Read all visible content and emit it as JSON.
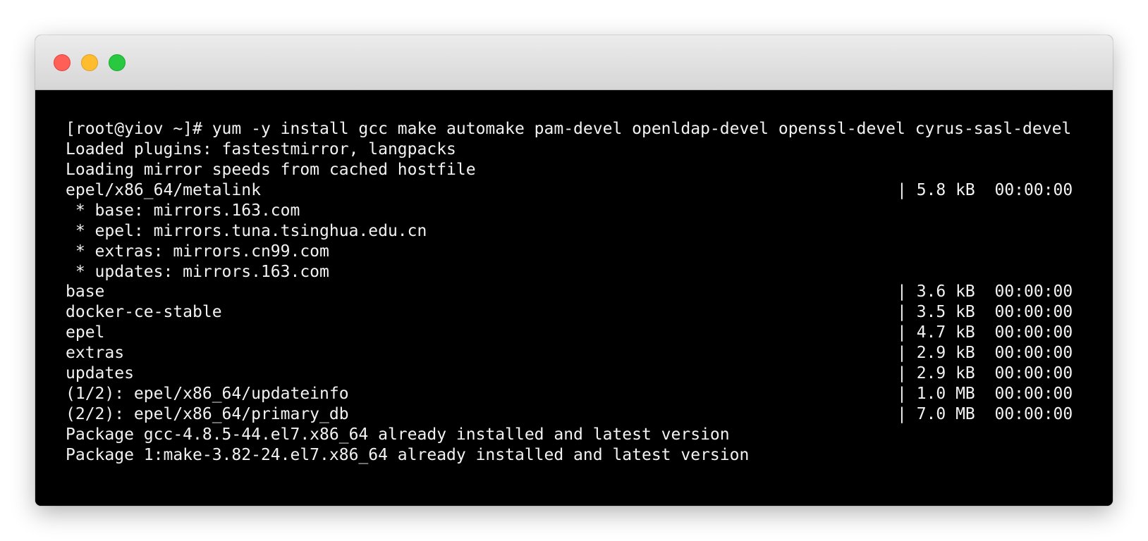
{
  "window": {
    "colors": {
      "close": "#ff5f57",
      "minimize": "#febc2e",
      "zoom": "#28c840",
      "terminal_bg": "#000000",
      "text": "#f2f2f2"
    }
  },
  "terminal": {
    "lines": [
      {
        "text": "[root@yiov ~]# yum -y install gcc make automake pam-devel openldap-devel openssl-devel cyrus-sasl-devel"
      },
      {
        "text": "Loaded plugins: fastestmirror, langpacks"
      },
      {
        "text": "Loading mirror speeds from cached hostfile"
      },
      {
        "text": "epel/x86_64/metalink",
        "stat": "| 5.8 kB  00:00:00"
      },
      {
        "text": " * base: mirrors.163.com"
      },
      {
        "text": " * epel: mirrors.tuna.tsinghua.edu.cn"
      },
      {
        "text": " * extras: mirrors.cn99.com"
      },
      {
        "text": " * updates: mirrors.163.com"
      },
      {
        "text": "base",
        "stat": "| 3.6 kB  00:00:00"
      },
      {
        "text": "docker-ce-stable",
        "stat": "| 3.5 kB  00:00:00"
      },
      {
        "text": "epel",
        "stat": "| 4.7 kB  00:00:00"
      },
      {
        "text": "extras",
        "stat": "| 2.9 kB  00:00:00"
      },
      {
        "text": "updates",
        "stat": "| 2.9 kB  00:00:00"
      },
      {
        "text": "(1/2): epel/x86_64/updateinfo",
        "stat": "| 1.0 MB  00:00:00"
      },
      {
        "text": "(2/2): epel/x86_64/primary_db",
        "stat": "| 7.0 MB  00:00:00"
      },
      {
        "text": "Package gcc-4.8.5-44.el7.x86_64 already installed and latest version"
      },
      {
        "text": "Package 1:make-3.82-24.el7.x86_64 already installed and latest version"
      }
    ]
  }
}
